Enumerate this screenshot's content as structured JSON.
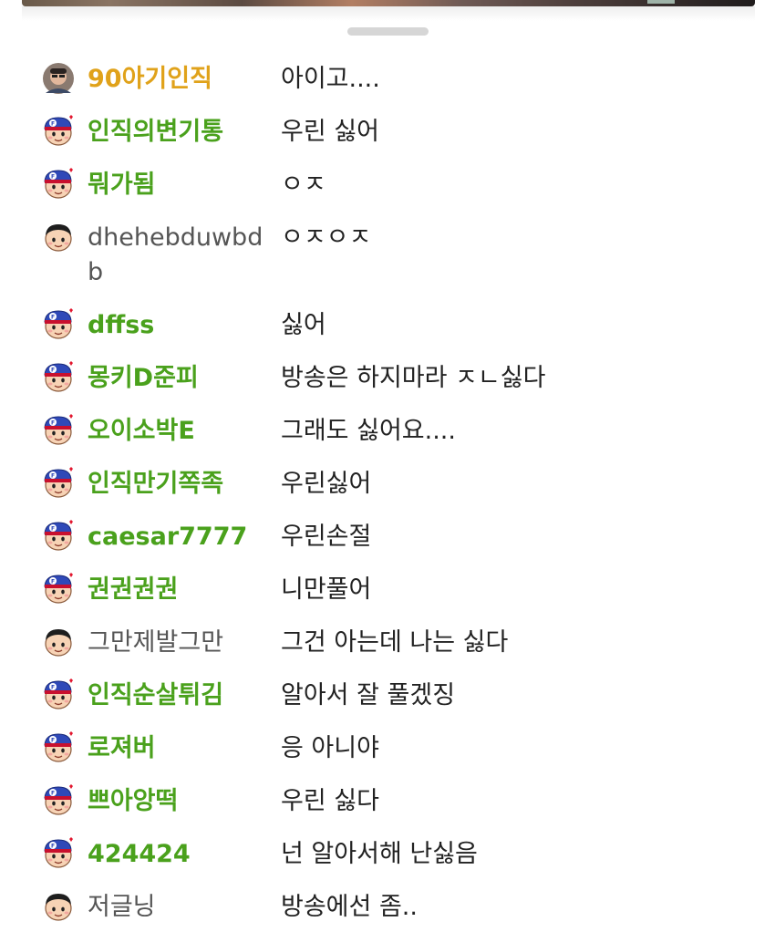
{
  "chat": {
    "messages": [
      {
        "nickname": "90아기인직",
        "text": "아이고....",
        "role": "vip",
        "avatar": "photo-avatar-icon"
      },
      {
        "nickname": "인직의변기통",
        "text": "우린 싫어",
        "role": "fan",
        "avatar": "fan-badge-avatar-icon"
      },
      {
        "nickname": "뭐가됨",
        "text": "ㅇㅈ",
        "role": "fan",
        "avatar": "fan-badge-avatar-icon"
      },
      {
        "nickname": "dhehebduwbdb",
        "text": "ㅇㅈㅇㅈ",
        "role": "viewer",
        "avatar": "default-avatar-icon"
      },
      {
        "nickname": "dffss",
        "text": "싫어",
        "role": "fan",
        "avatar": "fan-badge-avatar-icon"
      },
      {
        "nickname": "몽키D준피",
        "text": "방송은 하지마라 ㅈㄴ싫다",
        "role": "fan",
        "avatar": "fan-badge-avatar-icon"
      },
      {
        "nickname": "오이소박E",
        "text": "그래도 싫어요....",
        "role": "fan",
        "avatar": "fan-badge-avatar-icon"
      },
      {
        "nickname": "인직만기쪽족",
        "text": "우린싫어",
        "role": "fan",
        "avatar": "fan-badge-avatar-icon"
      },
      {
        "nickname": "caesar7777",
        "text": "우린손절",
        "role": "fan",
        "avatar": "fan-badge-avatar-icon"
      },
      {
        "nickname": "권권권권",
        "text": "니만풀어",
        "role": "fan",
        "avatar": "fan-badge-avatar-icon"
      },
      {
        "nickname": "그만제발그만",
        "text": "그건 아는데 나는 싫다",
        "role": "viewer",
        "avatar": "default-avatar-icon"
      },
      {
        "nickname": "인직순살튀김",
        "text": "알아서 잘 풀겠징",
        "role": "fan",
        "avatar": "fan-badge-avatar-icon"
      },
      {
        "nickname": "로져버",
        "text": "응 아니야",
        "role": "fan",
        "avatar": "fan-badge-avatar-icon"
      },
      {
        "nickname": "쁘아앙떡",
        "text": "우린 싫다",
        "role": "fan",
        "avatar": "fan-badge-avatar-icon"
      },
      {
        "nickname": "424424",
        "text": "넌 알아서해 난싫음",
        "role": "fan",
        "avatar": "fan-badge-avatar-icon"
      },
      {
        "nickname": "저글닝",
        "text": "방송에선 좀..",
        "role": "viewer",
        "avatar": "default-avatar-icon"
      }
    ]
  },
  "colors": {
    "fan_nick": "#4aa11c",
    "vip_nick": "#e0a21a",
    "viewer_nick": "#555555",
    "message_text": "#222222"
  }
}
